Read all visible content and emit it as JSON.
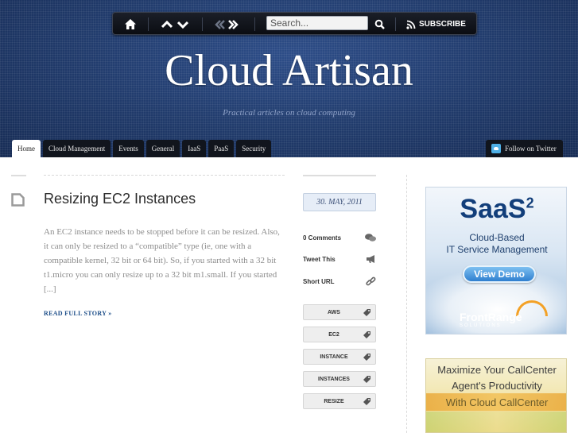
{
  "toolbar": {
    "search_placeholder": "Search...",
    "subscribe_label": "SUBSCRIBE"
  },
  "site": {
    "title": "Cloud Artisan",
    "tagline": "Practical articles on cloud computing"
  },
  "nav": {
    "tabs": [
      {
        "label": "Home"
      },
      {
        "label": "Cloud Management"
      },
      {
        "label": "Events"
      },
      {
        "label": "General"
      },
      {
        "label": "IaaS"
      },
      {
        "label": "PaaS"
      },
      {
        "label": "Security"
      }
    ],
    "follow_label": "Follow on Twitter"
  },
  "post": {
    "title": "Resizing EC2 Instances",
    "excerpt": "An EC2 instance needs to be stopped before it can be resized. Also, it can only be resized to a “compatible” type (ie, one with a compatible kernel, 32 bit or 64 bit). So, if you started with a 32 bit t1.micro you can only resize up to a 32 bit m1.small. If you started [...]",
    "read_more": "READ FULL STORY »",
    "date": "30. MAY, 2011",
    "comments": "0 Comments",
    "tweet": "Tweet This",
    "short_url": "Short URL",
    "tags": [
      "AWS",
      "EC2",
      "INSTANCE",
      "INSTANCES",
      "RESIZE"
    ]
  },
  "ads": {
    "ad1": {
      "title": "SaaS",
      "title_sup": "2",
      "line1": "Cloud-Based",
      "line2": "IT Service Management",
      "button": "View Demo",
      "logo": "FrontRange",
      "logo_sub": "SOLUTIONS"
    },
    "ad2": {
      "line1": "Maximize Your CallCenter",
      "line2": "Agent's Productivity",
      "line3": "With Cloud CallCenter"
    }
  },
  "colors": {
    "header_bg": "#213a6c",
    "nav_bg": "#11151d",
    "link": "#1d4e89"
  }
}
